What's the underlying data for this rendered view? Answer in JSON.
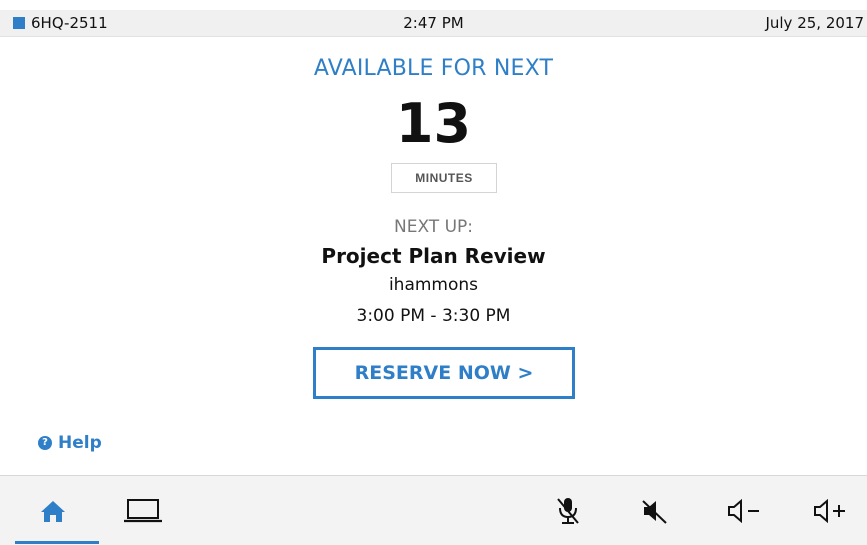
{
  "status": {
    "room": "6HQ-2511",
    "time": "2:47 PM",
    "date": "July 25, 2017"
  },
  "availability": {
    "heading": "AVAILABLE FOR NEXT",
    "count": "13",
    "units": "MINUTES"
  },
  "next_meeting": {
    "label": "NEXT UP:",
    "title": "Project Plan Review",
    "organizer": "ihammons",
    "time_range": "3:00 PM - 3:30 PM"
  },
  "actions": {
    "reserve_label": "RESERVE NOW >",
    "help_label": "Help",
    "help_glyph": "?"
  },
  "toolbar": {
    "items": [
      "home-icon",
      "laptop-icon",
      "mic-mute-icon",
      "speaker-mute-icon",
      "volume-down-icon",
      "volume-up-icon"
    ],
    "active": "home-icon"
  },
  "colors": {
    "accent": "#2f7fc8",
    "text": "#111111",
    "muted": "#777777",
    "toolbar_bg": "#f3f3f3",
    "statusbar_bg": "#f0f0f0"
  }
}
